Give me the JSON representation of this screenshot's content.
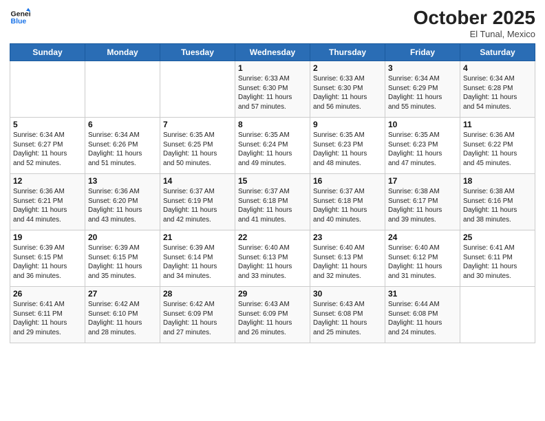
{
  "logo": {
    "line1": "General",
    "line2": "Blue"
  },
  "header": {
    "month": "October 2025",
    "location": "El Tunal, Mexico"
  },
  "weekdays": [
    "Sunday",
    "Monday",
    "Tuesday",
    "Wednesday",
    "Thursday",
    "Friday",
    "Saturday"
  ],
  "weeks": [
    [
      {
        "day": "",
        "info": ""
      },
      {
        "day": "",
        "info": ""
      },
      {
        "day": "",
        "info": ""
      },
      {
        "day": "1",
        "info": "Sunrise: 6:33 AM\nSunset: 6:30 PM\nDaylight: 11 hours\nand 57 minutes."
      },
      {
        "day": "2",
        "info": "Sunrise: 6:33 AM\nSunset: 6:30 PM\nDaylight: 11 hours\nand 56 minutes."
      },
      {
        "day": "3",
        "info": "Sunrise: 6:34 AM\nSunset: 6:29 PM\nDaylight: 11 hours\nand 55 minutes."
      },
      {
        "day": "4",
        "info": "Sunrise: 6:34 AM\nSunset: 6:28 PM\nDaylight: 11 hours\nand 54 minutes."
      }
    ],
    [
      {
        "day": "5",
        "info": "Sunrise: 6:34 AM\nSunset: 6:27 PM\nDaylight: 11 hours\nand 52 minutes."
      },
      {
        "day": "6",
        "info": "Sunrise: 6:34 AM\nSunset: 6:26 PM\nDaylight: 11 hours\nand 51 minutes."
      },
      {
        "day": "7",
        "info": "Sunrise: 6:35 AM\nSunset: 6:25 PM\nDaylight: 11 hours\nand 50 minutes."
      },
      {
        "day": "8",
        "info": "Sunrise: 6:35 AM\nSunset: 6:24 PM\nDaylight: 11 hours\nand 49 minutes."
      },
      {
        "day": "9",
        "info": "Sunrise: 6:35 AM\nSunset: 6:23 PM\nDaylight: 11 hours\nand 48 minutes."
      },
      {
        "day": "10",
        "info": "Sunrise: 6:35 AM\nSunset: 6:23 PM\nDaylight: 11 hours\nand 47 minutes."
      },
      {
        "day": "11",
        "info": "Sunrise: 6:36 AM\nSunset: 6:22 PM\nDaylight: 11 hours\nand 45 minutes."
      }
    ],
    [
      {
        "day": "12",
        "info": "Sunrise: 6:36 AM\nSunset: 6:21 PM\nDaylight: 11 hours\nand 44 minutes."
      },
      {
        "day": "13",
        "info": "Sunrise: 6:36 AM\nSunset: 6:20 PM\nDaylight: 11 hours\nand 43 minutes."
      },
      {
        "day": "14",
        "info": "Sunrise: 6:37 AM\nSunset: 6:19 PM\nDaylight: 11 hours\nand 42 minutes."
      },
      {
        "day": "15",
        "info": "Sunrise: 6:37 AM\nSunset: 6:18 PM\nDaylight: 11 hours\nand 41 minutes."
      },
      {
        "day": "16",
        "info": "Sunrise: 6:37 AM\nSunset: 6:18 PM\nDaylight: 11 hours\nand 40 minutes."
      },
      {
        "day": "17",
        "info": "Sunrise: 6:38 AM\nSunset: 6:17 PM\nDaylight: 11 hours\nand 39 minutes."
      },
      {
        "day": "18",
        "info": "Sunrise: 6:38 AM\nSunset: 6:16 PM\nDaylight: 11 hours\nand 38 minutes."
      }
    ],
    [
      {
        "day": "19",
        "info": "Sunrise: 6:39 AM\nSunset: 6:15 PM\nDaylight: 11 hours\nand 36 minutes."
      },
      {
        "day": "20",
        "info": "Sunrise: 6:39 AM\nSunset: 6:15 PM\nDaylight: 11 hours\nand 35 minutes."
      },
      {
        "day": "21",
        "info": "Sunrise: 6:39 AM\nSunset: 6:14 PM\nDaylight: 11 hours\nand 34 minutes."
      },
      {
        "day": "22",
        "info": "Sunrise: 6:40 AM\nSunset: 6:13 PM\nDaylight: 11 hours\nand 33 minutes."
      },
      {
        "day": "23",
        "info": "Sunrise: 6:40 AM\nSunset: 6:13 PM\nDaylight: 11 hours\nand 32 minutes."
      },
      {
        "day": "24",
        "info": "Sunrise: 6:40 AM\nSunset: 6:12 PM\nDaylight: 11 hours\nand 31 minutes."
      },
      {
        "day": "25",
        "info": "Sunrise: 6:41 AM\nSunset: 6:11 PM\nDaylight: 11 hours\nand 30 minutes."
      }
    ],
    [
      {
        "day": "26",
        "info": "Sunrise: 6:41 AM\nSunset: 6:11 PM\nDaylight: 11 hours\nand 29 minutes."
      },
      {
        "day": "27",
        "info": "Sunrise: 6:42 AM\nSunset: 6:10 PM\nDaylight: 11 hours\nand 28 minutes."
      },
      {
        "day": "28",
        "info": "Sunrise: 6:42 AM\nSunset: 6:09 PM\nDaylight: 11 hours\nand 27 minutes."
      },
      {
        "day": "29",
        "info": "Sunrise: 6:43 AM\nSunset: 6:09 PM\nDaylight: 11 hours\nand 26 minutes."
      },
      {
        "day": "30",
        "info": "Sunrise: 6:43 AM\nSunset: 6:08 PM\nDaylight: 11 hours\nand 25 minutes."
      },
      {
        "day": "31",
        "info": "Sunrise: 6:44 AM\nSunset: 6:08 PM\nDaylight: 11 hours\nand 24 minutes."
      },
      {
        "day": "",
        "info": ""
      }
    ]
  ]
}
